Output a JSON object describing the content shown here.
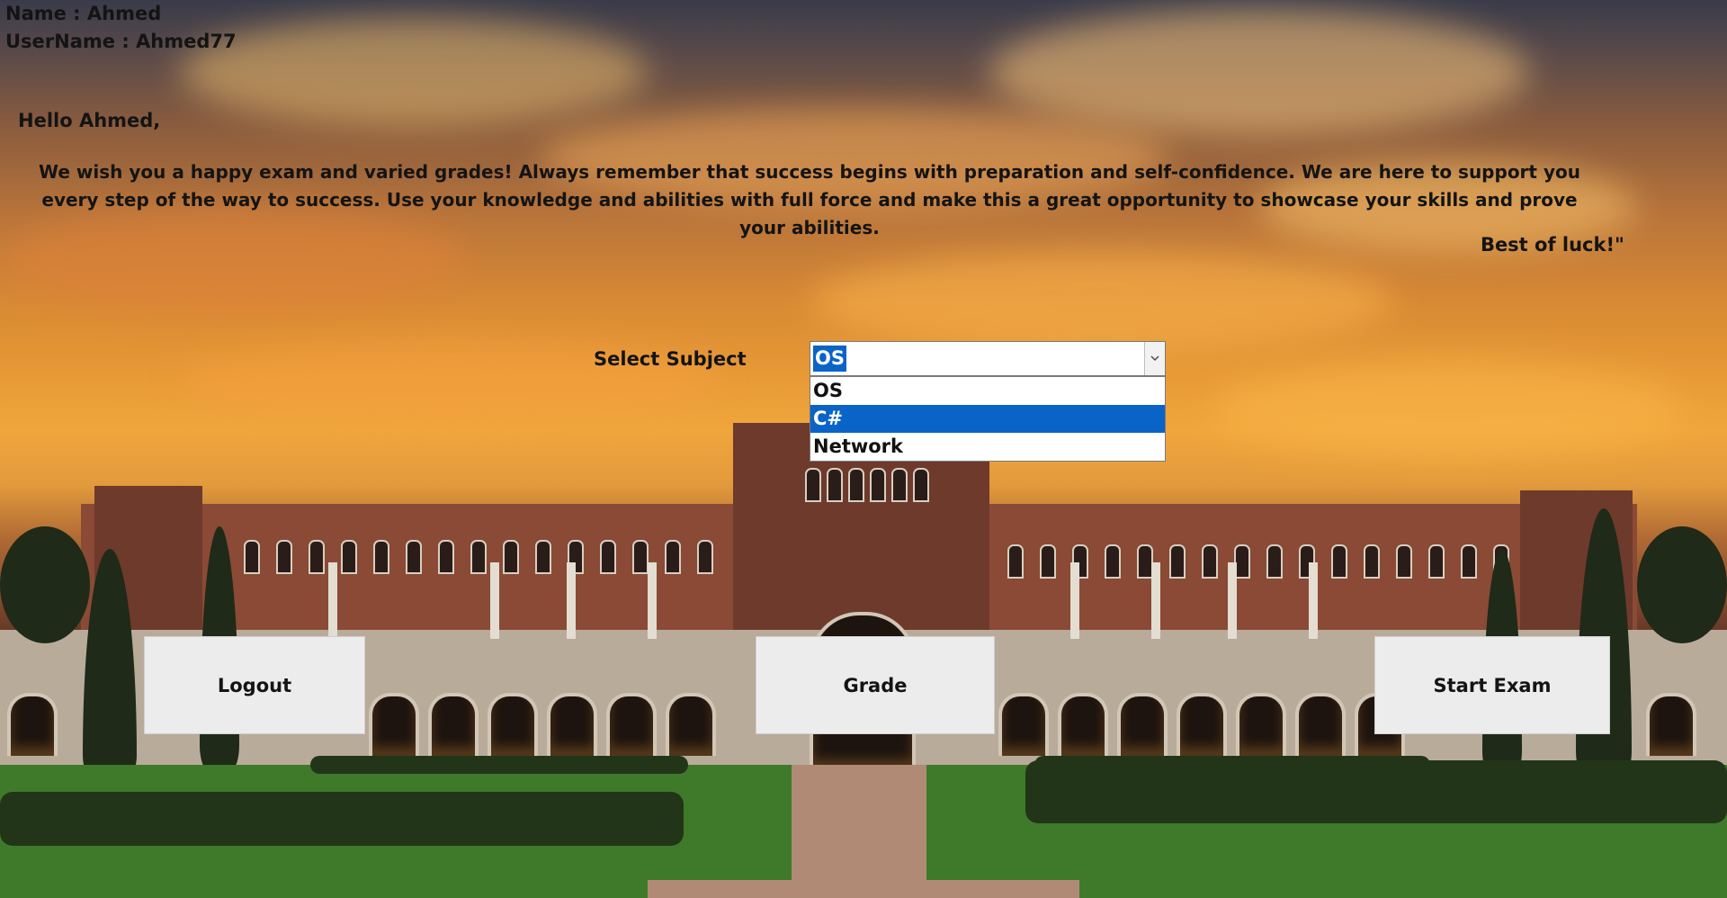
{
  "user": {
    "name_line": "Name : Ahmed",
    "username_line": "UserName : Ahmed77"
  },
  "greeting": "Hello Ahmed,",
  "message": "We wish you a happy exam and varied grades! Always remember that success begins with preparation and self-confidence. We are here to support you every step of the way to success. Use your knowledge and abilities with full force and make this a great opportunity to showcase your skills and prove your abilities.",
  "closing": "Best of luck!\"",
  "subject": {
    "label": "Select Subject",
    "selected": "OS",
    "options": [
      "OS",
      "C#",
      "Network"
    ],
    "highlighted": "C#",
    "arrow_icon": "chevron-down-icon"
  },
  "buttons": {
    "logout": "Logout",
    "grade": "Grade",
    "start_exam": "Start Exam"
  },
  "colors": {
    "selection": "#0a64c8",
    "button_bg": "#ececec",
    "text": "#141414"
  }
}
